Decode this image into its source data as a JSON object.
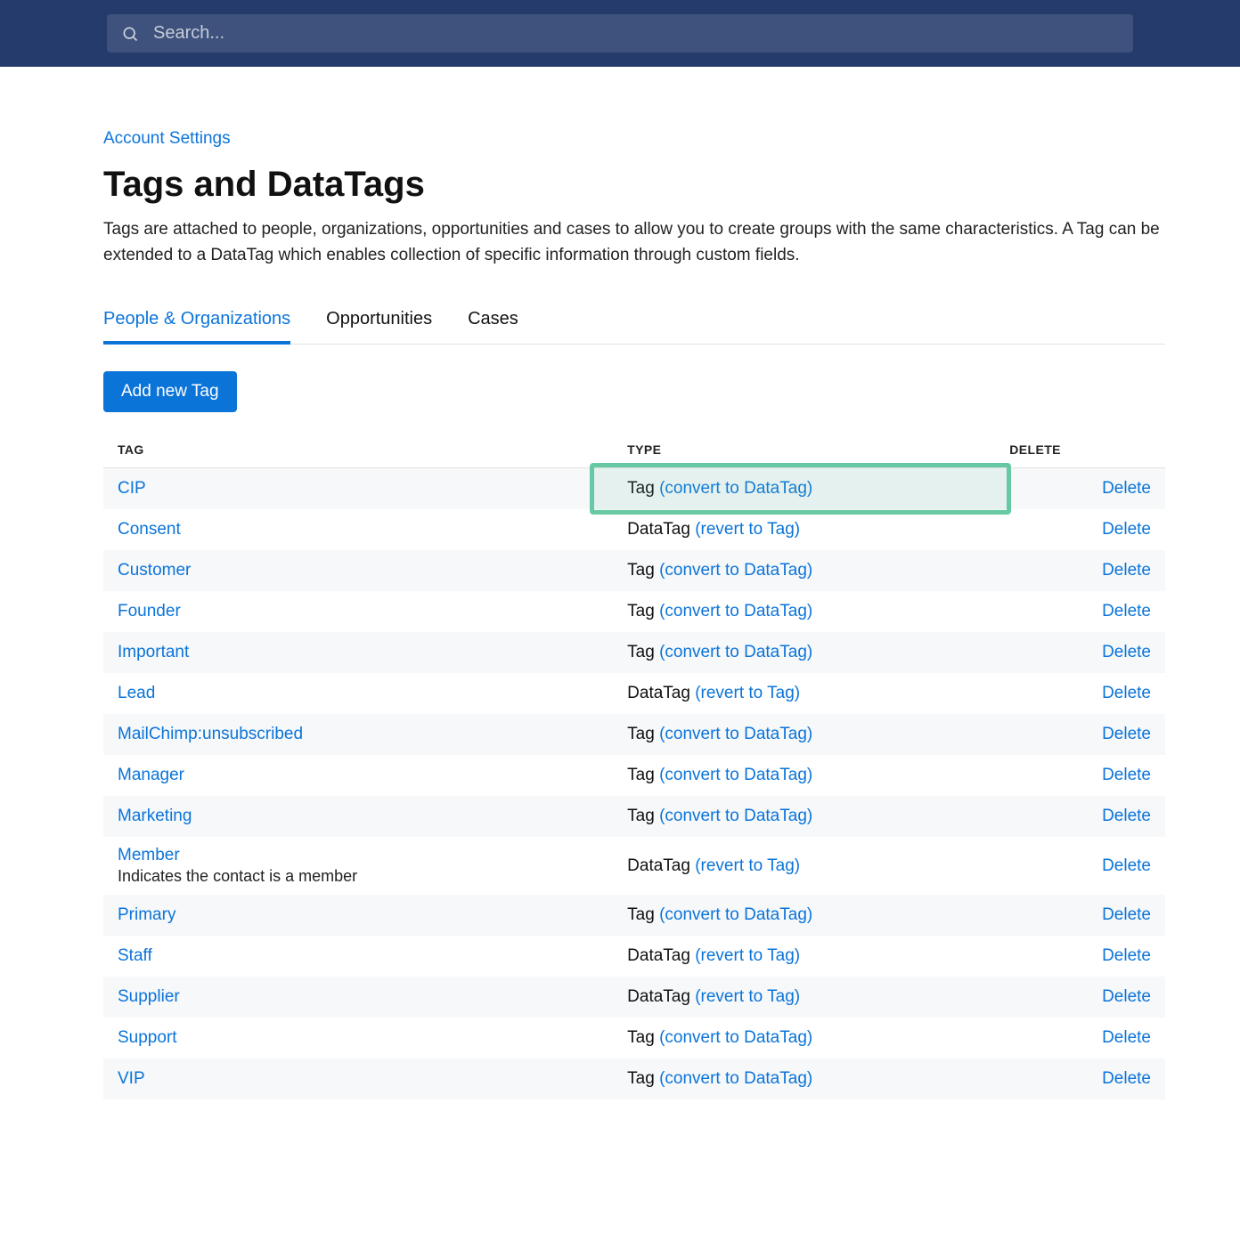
{
  "search": {
    "placeholder": "Search..."
  },
  "breadcrumb": {
    "label": "Account Settings"
  },
  "title": "Tags and DataTags",
  "description": "Tags are attached to people, organizations, opportunities and cases to allow you to create groups with the same characteristics. A Tag can be extended to a DataTag which enables collection of specific information through custom fields.",
  "tabs": [
    {
      "label": "People & Organizations",
      "active": true
    },
    {
      "label": "Opportunities",
      "active": false
    },
    {
      "label": "Cases",
      "active": false
    }
  ],
  "add_button": "Add new Tag",
  "table": {
    "headers": {
      "tag": "TAG",
      "type": "TYPE",
      "delete": "DELETE"
    },
    "rows": [
      {
        "name": "CIP",
        "type": "Tag",
        "action": "(convert to DataTag)",
        "delete": "Delete",
        "highlight": true
      },
      {
        "name": "Consent",
        "type": "DataTag",
        "action": "(revert to Tag)",
        "delete": "Delete"
      },
      {
        "name": "Customer",
        "type": "Tag",
        "action": "(convert to DataTag)",
        "delete": "Delete"
      },
      {
        "name": "Founder",
        "type": "Tag",
        "action": "(convert to DataTag)",
        "delete": "Delete"
      },
      {
        "name": "Important",
        "type": "Tag",
        "action": "(convert to DataTag)",
        "delete": "Delete"
      },
      {
        "name": "Lead",
        "type": "DataTag",
        "action": "(revert to Tag)",
        "delete": "Delete"
      },
      {
        "name": "MailChimp:unsubscribed",
        "type": "Tag",
        "action": "(convert to DataTag)",
        "delete": "Delete"
      },
      {
        "name": "Manager",
        "type": "Tag",
        "action": "(convert to DataTag)",
        "delete": "Delete"
      },
      {
        "name": "Marketing",
        "type": "Tag",
        "action": "(convert to DataTag)",
        "delete": "Delete"
      },
      {
        "name": "Member",
        "note": "Indicates the contact is a member",
        "type": "DataTag",
        "action": "(revert to Tag)",
        "delete": "Delete"
      },
      {
        "name": "Primary",
        "type": "Tag",
        "action": "(convert to DataTag)",
        "delete": "Delete"
      },
      {
        "name": "Staff",
        "type": "DataTag",
        "action": "(revert to Tag)",
        "delete": "Delete"
      },
      {
        "name": "Supplier",
        "type": "DataTag",
        "action": "(revert to Tag)",
        "delete": "Delete"
      },
      {
        "name": "Support",
        "type": "Tag",
        "action": "(convert to DataTag)",
        "delete": "Delete"
      },
      {
        "name": "VIP",
        "type": "Tag",
        "action": "(convert to DataTag)",
        "delete": "Delete"
      }
    ]
  }
}
